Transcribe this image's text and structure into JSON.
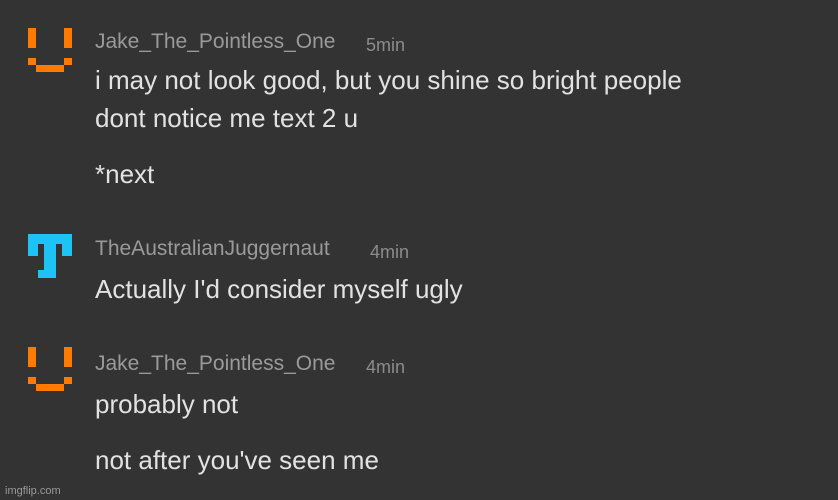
{
  "colors": {
    "background": "#333333",
    "username": "#9a9a9a",
    "time": "#8c8c8c",
    "message": "#e2e2e2",
    "avatar_orange": "#ff7a00",
    "avatar_blue": "#1ec3f5"
  },
  "comments": [
    {
      "avatar_icon": "orange-smiley-icon",
      "username": "Jake_The_Pointless_One",
      "time": "5min",
      "lines": [
        "i may not look good, but you shine so bright people",
        "dont notice me text 2 u",
        "*next"
      ]
    },
    {
      "avatar_icon": "blue-t-icon",
      "username": "TheAustralianJuggernaut",
      "time": "4min",
      "lines": [
        "Actually I'd consider myself ugly"
      ]
    },
    {
      "avatar_icon": "orange-smiley-icon",
      "username": "Jake_The_Pointless_One",
      "time": "4min",
      "lines": [
        "probably not",
        "not after you've seen me"
      ]
    }
  ],
  "watermark": "imgflip.com"
}
